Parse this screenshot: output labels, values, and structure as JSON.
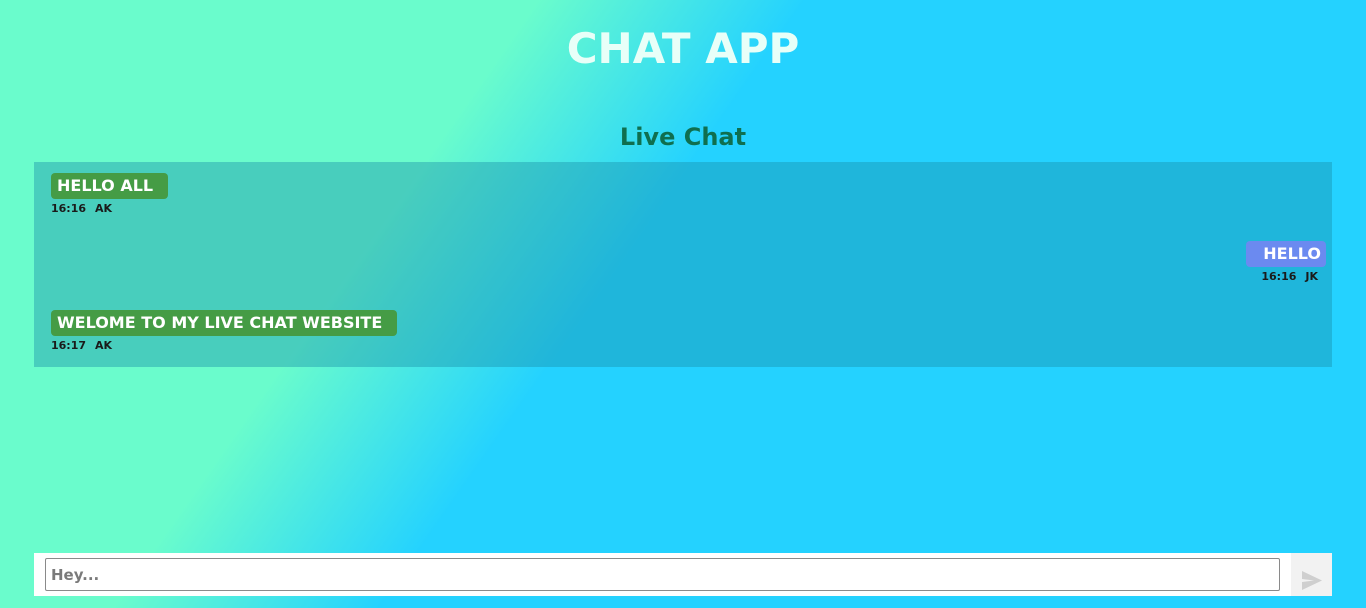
{
  "app": {
    "title": "CHAT APP"
  },
  "chat": {
    "heading": "Live Chat",
    "messages": [
      {
        "text": "HELLO ALL",
        "time": "16:16",
        "author": "AK",
        "side": "left"
      },
      {
        "text": "HELLO",
        "time": "16:16",
        "author": "JK",
        "side": "right"
      },
      {
        "text": "WELOME TO MY LIVE CHAT WEBSITE",
        "time": "16:17",
        "author": "AK",
        "side": "left"
      }
    ]
  },
  "composer": {
    "placeholder": "Hey...",
    "value": "",
    "send_icon": "send-arrow-icon"
  },
  "colors": {
    "gradient_start": "#6afccc",
    "gradient_end": "#24d2ff",
    "left_bubble": "#459c45",
    "right_bubble": "#6b8af0",
    "heading": "#0f6f4f"
  }
}
